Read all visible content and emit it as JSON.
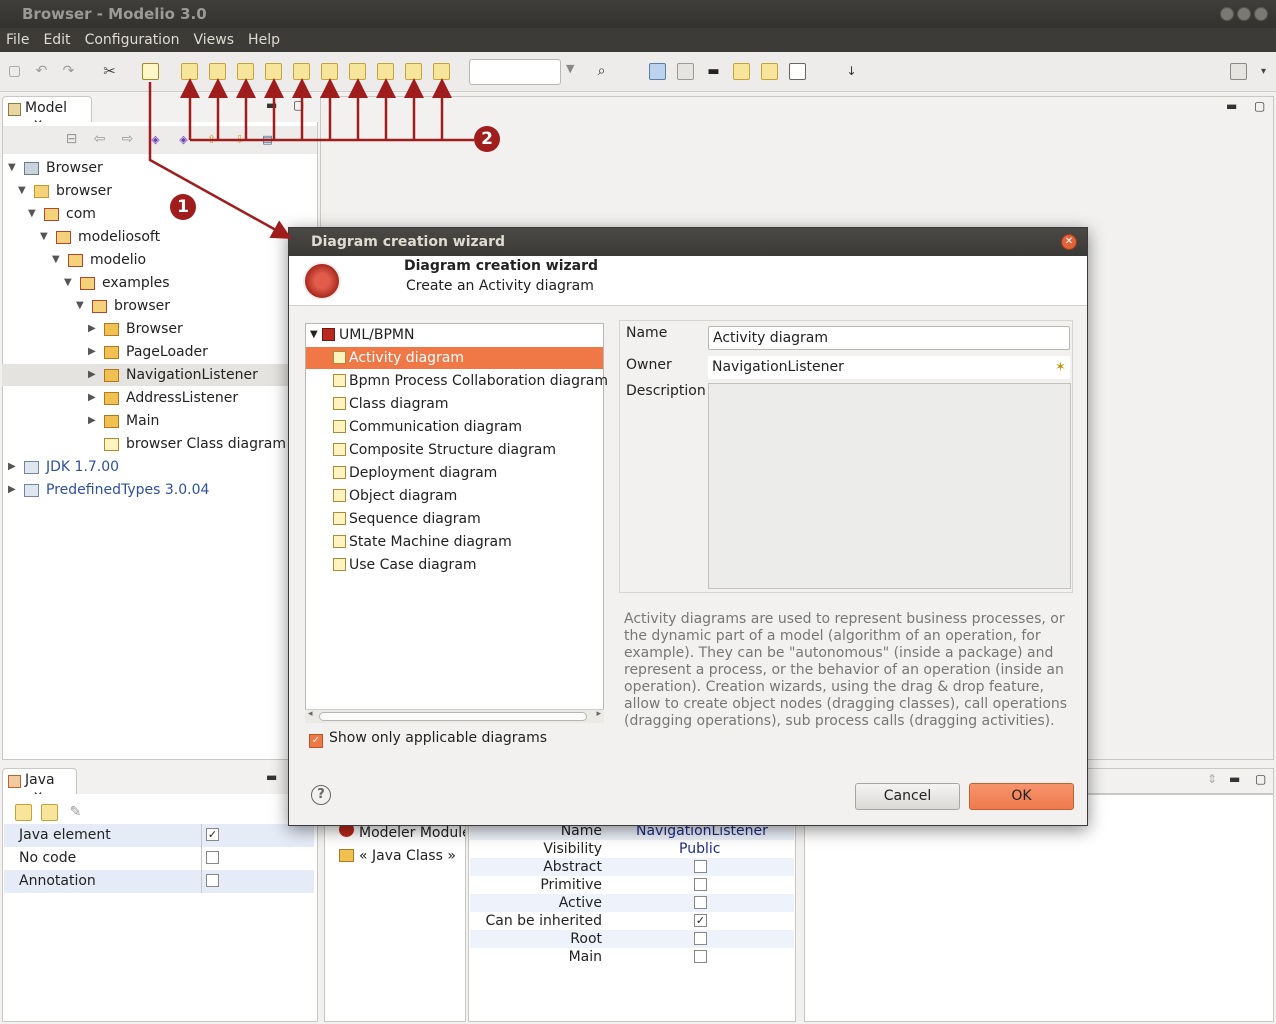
{
  "window": {
    "title": "Browser - Modelio 3.0"
  },
  "menu": [
    "File",
    "Edit",
    "Configuration",
    "Views",
    "Help"
  ],
  "model_panel": {
    "tab_label": "Model",
    "tree": [
      {
        "label": "Browser",
        "type": "root"
      },
      {
        "label": "browser",
        "type": "folder"
      },
      {
        "label": "com",
        "type": "pkg"
      },
      {
        "label": "modeliosoft",
        "type": "pkg"
      },
      {
        "label": "modelio",
        "type": "pkg"
      },
      {
        "label": "examples",
        "type": "pkg"
      },
      {
        "label": "browser",
        "type": "pkg"
      },
      {
        "label": "Browser",
        "type": "cls"
      },
      {
        "label": "PageLoader",
        "type": "cls"
      },
      {
        "label": "NavigationListener",
        "type": "cls"
      },
      {
        "label": "AddressListener",
        "type": "cls"
      },
      {
        "label": "Main",
        "type": "cls"
      },
      {
        "label": "browser Class diagram",
        "type": "diagram"
      },
      {
        "label": "JDK 1.7.00",
        "type": "lib"
      },
      {
        "label": "PredefinedTypes 3.0.04",
        "type": "lib"
      }
    ]
  },
  "java_panel": {
    "tab_label": "Java",
    "rows": [
      {
        "label": "Java element",
        "checked": true
      },
      {
        "label": "No code",
        "checked": false
      },
      {
        "label": "Annotation",
        "checked": false
      }
    ]
  },
  "module_panel": {
    "items": [
      "Modeler Module",
      "« Java Class »"
    ]
  },
  "properties": {
    "name_label": "Name",
    "name_value": "NavigationListener",
    "visibility_label": "Visibility",
    "visibility_value": "Public",
    "flags": [
      {
        "label": "Abstract",
        "checked": false
      },
      {
        "label": "Primitive",
        "checked": false
      },
      {
        "label": "Active",
        "checked": false
      },
      {
        "label": "Can be inherited",
        "checked": true
      },
      {
        "label": "Root",
        "checked": false
      },
      {
        "label": "Main",
        "checked": false
      }
    ]
  },
  "dialog": {
    "title": "Diagram creation wizard",
    "header_title": "Diagram creation wizard",
    "header_subtitle": "Create an Activity diagram",
    "category": "UML/BPMN",
    "diagrams": [
      "Activity diagram",
      "Bpmn Process Collaboration diagram",
      "Class diagram",
      "Communication diagram",
      "Composite Structure diagram",
      "Deployment diagram",
      "Object diagram",
      "Sequence diagram",
      "State Machine diagram",
      "Use Case diagram"
    ],
    "selected_index": 0,
    "name_label": "Name",
    "name_value": "Activity diagram",
    "owner_label": "Owner",
    "owner_value": "NavigationListener",
    "description_label": "Description",
    "help_text": "Activity diagrams are used to represent business processes, or the dynamic part of a model (algorithm of an operation, for example). They can be \"autonomous\" (inside a package) and represent a process, or the behavior of an operation (inside an operation). Creation wizards, using the drag & drop feature, allow to create object nodes (dragging classes), call operations (dragging operations), sub process calls (dragging activities).",
    "checkbox_label": "Show only applicable diagrams",
    "checkbox_checked": true,
    "cancel_label": "Cancel",
    "ok_label": "OK",
    "help_icon": "?"
  },
  "callouts": [
    "1",
    "2"
  ],
  "colors": {
    "accent": "#f07746",
    "callout": "#a01d1d"
  }
}
